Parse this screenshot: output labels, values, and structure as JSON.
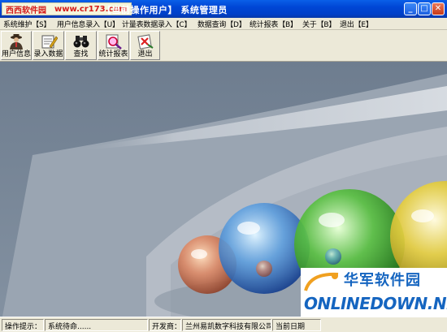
{
  "window": {
    "watermark_brand": "西西软件园",
    "watermark_url": "www.cr173.com",
    "title": "【当前操作用户】 系统管理员",
    "controls": {
      "minimize": "_",
      "maximize": "□",
      "close": "✕"
    }
  },
  "menu": [
    {
      "label": "系统维护【S】"
    },
    {
      "label": "用户信息录入【U】"
    },
    {
      "label": "计量表数据录入【C】"
    },
    {
      "label": "数据查询【D】"
    },
    {
      "label": "统计报表【B】"
    },
    {
      "label": "关于【B】"
    },
    {
      "label": "退出【E】"
    }
  ],
  "toolbar": [
    {
      "label": "用户信息",
      "icon": "user-icon"
    },
    {
      "label": "录入数据",
      "icon": "data-entry-icon"
    },
    {
      "label": "查找",
      "icon": "binoculars-icon"
    },
    {
      "label": "统计报表",
      "icon": "report-magnifier-icon"
    },
    {
      "label": "退出",
      "icon": "exit-icon"
    }
  ],
  "status": {
    "hint_label": "操作提示：",
    "hint_value": "系统待命......",
    "developer_label": "开发商：",
    "developer_value": "兰州易凯数字科技有限公司",
    "date_label": "当前日期"
  },
  "logo": {
    "cn": "华军软件园",
    "en": "ONLINEDOWN.NET"
  },
  "colors": {
    "titlebar": "#0046d5",
    "desktop": "#7e8d9e",
    "chrome": "#ece9d8",
    "brand_blue": "#1565c0"
  }
}
